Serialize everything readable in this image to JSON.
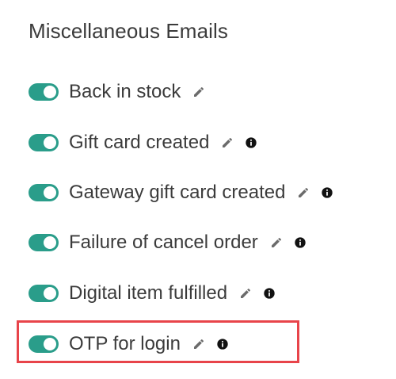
{
  "section": {
    "title": "Miscellaneous Emails"
  },
  "colors": {
    "toggle_on": "#2a9d8a",
    "highlight": "#e8444a",
    "text": "#3b3b3b",
    "icon": "#6b6b6b"
  },
  "emails": [
    {
      "label": "Back in stock",
      "enabled": true,
      "has_info": false
    },
    {
      "label": "Gift card created",
      "enabled": true,
      "has_info": true
    },
    {
      "label": "Gateway gift card created",
      "enabled": true,
      "has_info": true
    },
    {
      "label": "Failure of cancel order",
      "enabled": true,
      "has_info": true
    },
    {
      "label": "Digital item fulfilled",
      "enabled": true,
      "has_info": true
    },
    {
      "label": "OTP for login",
      "enabled": true,
      "has_info": true,
      "highlighted": true
    }
  ],
  "icons": {
    "edit": "pencil-icon",
    "info": "info-icon"
  }
}
